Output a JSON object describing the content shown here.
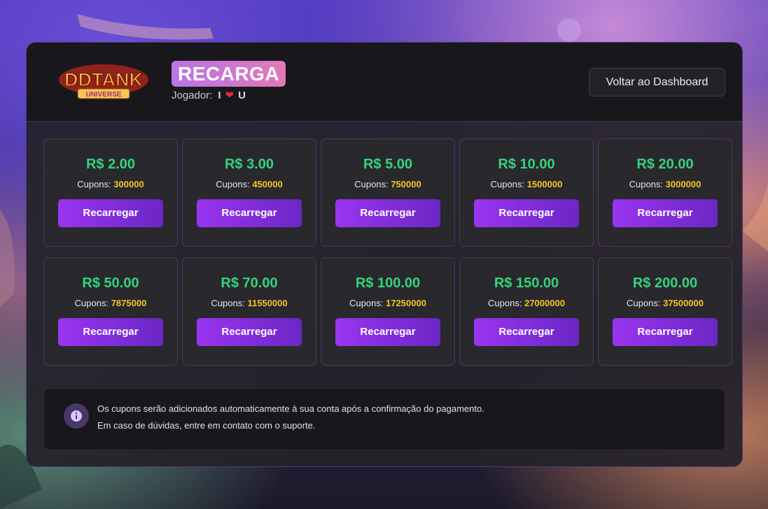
{
  "header": {
    "logo_text": "DDTANK",
    "logo_subtext": "UNIVERSE",
    "title": "RECARGA",
    "player_label": "Jogador:",
    "player_name_left": "I",
    "player_name_right": "U",
    "player_heart_icon": "heart-icon",
    "dashboard_button": "Voltar ao Dashboard"
  },
  "packages": [
    {
      "price": "R$ 2.00",
      "coupons_label": "Cupons:",
      "coupons": "300000",
      "button": "Recarregar"
    },
    {
      "price": "R$ 3.00",
      "coupons_label": "Cupons:",
      "coupons": "450000",
      "button": "Recarregar"
    },
    {
      "price": "R$ 5.00",
      "coupons_label": "Cupons:",
      "coupons": "750000",
      "button": "Recarregar"
    },
    {
      "price": "R$ 10.00",
      "coupons_label": "Cupons:",
      "coupons": "1500000",
      "button": "Recarregar"
    },
    {
      "price": "R$ 20.00",
      "coupons_label": "Cupons:",
      "coupons": "3000000",
      "button": "Recarregar"
    },
    {
      "price": "R$ 50.00",
      "coupons_label": "Cupons:",
      "coupons": "7875000",
      "button": "Recarregar"
    },
    {
      "price": "R$ 70.00",
      "coupons_label": "Cupons:",
      "coupons": "11550000",
      "button": "Recarregar"
    },
    {
      "price": "R$ 100.00",
      "coupons_label": "Cupons:",
      "coupons": "17250000",
      "button": "Recarregar"
    },
    {
      "price": "R$ 150.00",
      "coupons_label": "Cupons:",
      "coupons": "27000000",
      "button": "Recarregar"
    },
    {
      "price": "R$ 200.00",
      "coupons_label": "Cupons:",
      "coupons": "37500000",
      "button": "Recarregar"
    }
  ],
  "info": {
    "icon": "info-icon",
    "line1": "Os cupons serão adicionados automaticamente à sua conta após a confirmação do pagamento.",
    "line2": "Em caso de dúvidas, entre em contato com o suporte."
  },
  "colors": {
    "price": "#33d47c",
    "coupon_value": "#f3c623",
    "button_start": "#9a34f1",
    "button_end": "#6b27c6",
    "title_badge_start": "#b975e8",
    "title_badge_end": "#e278b6"
  }
}
